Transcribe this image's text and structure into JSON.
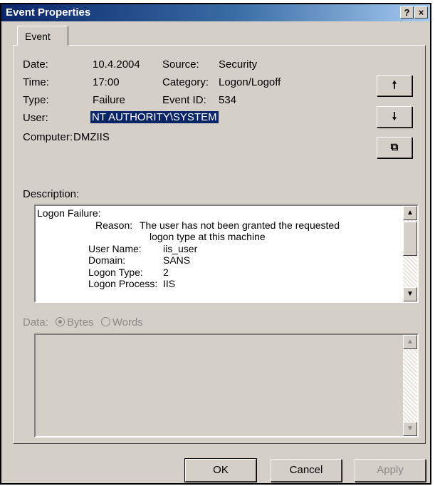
{
  "window": {
    "title": "Event Properties",
    "help_glyph": "?",
    "close_glyph": "×"
  },
  "tabs": [
    {
      "label": "Event"
    }
  ],
  "event": {
    "date_label": "Date:",
    "date": "10.4.2004",
    "time_label": "Time:",
    "time": "17:00",
    "type_label": "Type:",
    "type": "Failure",
    "user_label": "User:",
    "user": "NT AUTHORITY\\SYSTEM",
    "computer_label": "Computer:",
    "computer": "DMZIIS",
    "source_label": "Source:",
    "source": "Security",
    "category_label": "Category:",
    "category": "Logon/Logoff",
    "event_id_label": "Event ID:",
    "event_id": "534"
  },
  "side_buttons": {
    "up_icon": "arrow-up-icon",
    "up_glyph": "🠕",
    "down_icon": "arrow-down-icon",
    "down_glyph": "🠗",
    "copy_icon": "copy-icon",
    "copy_glyph": "⧉"
  },
  "description": {
    "label": "Description:",
    "lines": [
      {
        "indent": 0,
        "c1": "Logon Failure:",
        "c2": ""
      },
      {
        "indent": 2,
        "c1": "Reason:",
        "c2": "The user has not been granted the requested"
      },
      {
        "indent": 2,
        "c1": "",
        "c2": "logon type at this machine"
      },
      {
        "indent": 1,
        "c1": "User Name:",
        "c2": "iis_user"
      },
      {
        "indent": 1,
        "c1": "Domain:",
        "c2": "SANS"
      },
      {
        "indent": 1,
        "c1": "Logon Type:",
        "c2": "2"
      },
      {
        "indent": 1,
        "c1": "Logon Process:",
        "c2": "IIS"
      }
    ]
  },
  "data_section": {
    "label": "Data:",
    "options": [
      {
        "label": "Bytes",
        "selected": true
      },
      {
        "label": "Words",
        "selected": false
      }
    ]
  },
  "buttons": {
    "ok": "OK",
    "cancel": "Cancel",
    "apply": "Apply"
  }
}
